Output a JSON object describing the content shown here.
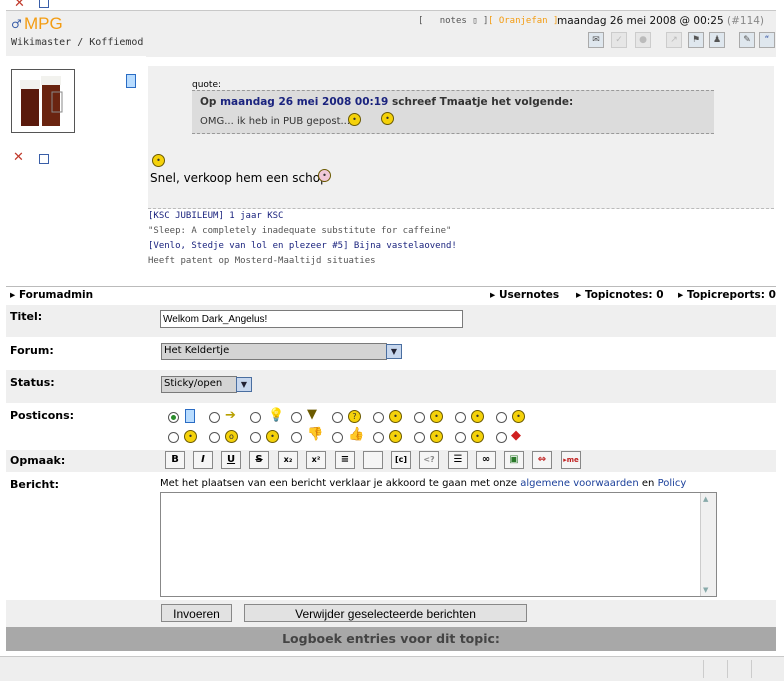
{
  "header": {
    "logo_text": "MPG",
    "user_line": "Wikimaster / Koffiemod",
    "notes_label": "notes",
    "author_tag": "[ Oranjefan ]",
    "post_date": "maandag 26 mei 2008 @ 00:25",
    "post_number": "(#114)"
  },
  "post": {
    "quote_label": "quote:",
    "quote_header_prefix": "Op",
    "quote_header_date": "maandag 26 mei 2008 00:19",
    "quote_header_suffix": "schreef Tmaatje het volgende:",
    "quote_text": "OMG... ik heb in PUB gepost...",
    "body": "Snel, verkoop hem een schop"
  },
  "signature": {
    "line1": "[KSC JUBILEUM] 1 jaar KSC",
    "line2": "\"Sleep: A completely inadequate substitute for caffeine\"",
    "line3": "[Venlo, Stedje van lol en plezeer #5] Bijna vastelaovend!",
    "line4": "Heeft patent op Mosterd-Maaltijd situaties"
  },
  "adminbar": {
    "forumadmin": "Forumadmin",
    "usernotes": "Usernotes",
    "topicnotes": "Topicnotes: 0",
    "topicreports": "Topicreports: 0"
  },
  "form": {
    "title_label": "Titel:",
    "title_value": "Welkom Dark_Angelus!",
    "forum_label": "Forum:",
    "forum_value": "Het Keldertje",
    "status_label": "Status:",
    "status_value": "Sticky/open",
    "posticons_label": "Posticons:",
    "opmaak_label": "Opmaak:",
    "bericht_label": "Bericht:",
    "terms_prefix": "Met het plaatsen van een bericht verklaar je akkoord te gaan met onze",
    "terms_link": "algemene voorwaarden",
    "terms_and": "en",
    "policy_link": "Policy",
    "submit_label": "Invoeren",
    "delete_label": "Verwijder geselecteerde berichten"
  },
  "logbook": {
    "title": "Logboek entries voor dit topic:"
  },
  "colors": {
    "accent": "#f39c12",
    "link": "#1a3f9a",
    "row_bg": "#efefef",
    "log_bar": "#a8a8a8"
  }
}
